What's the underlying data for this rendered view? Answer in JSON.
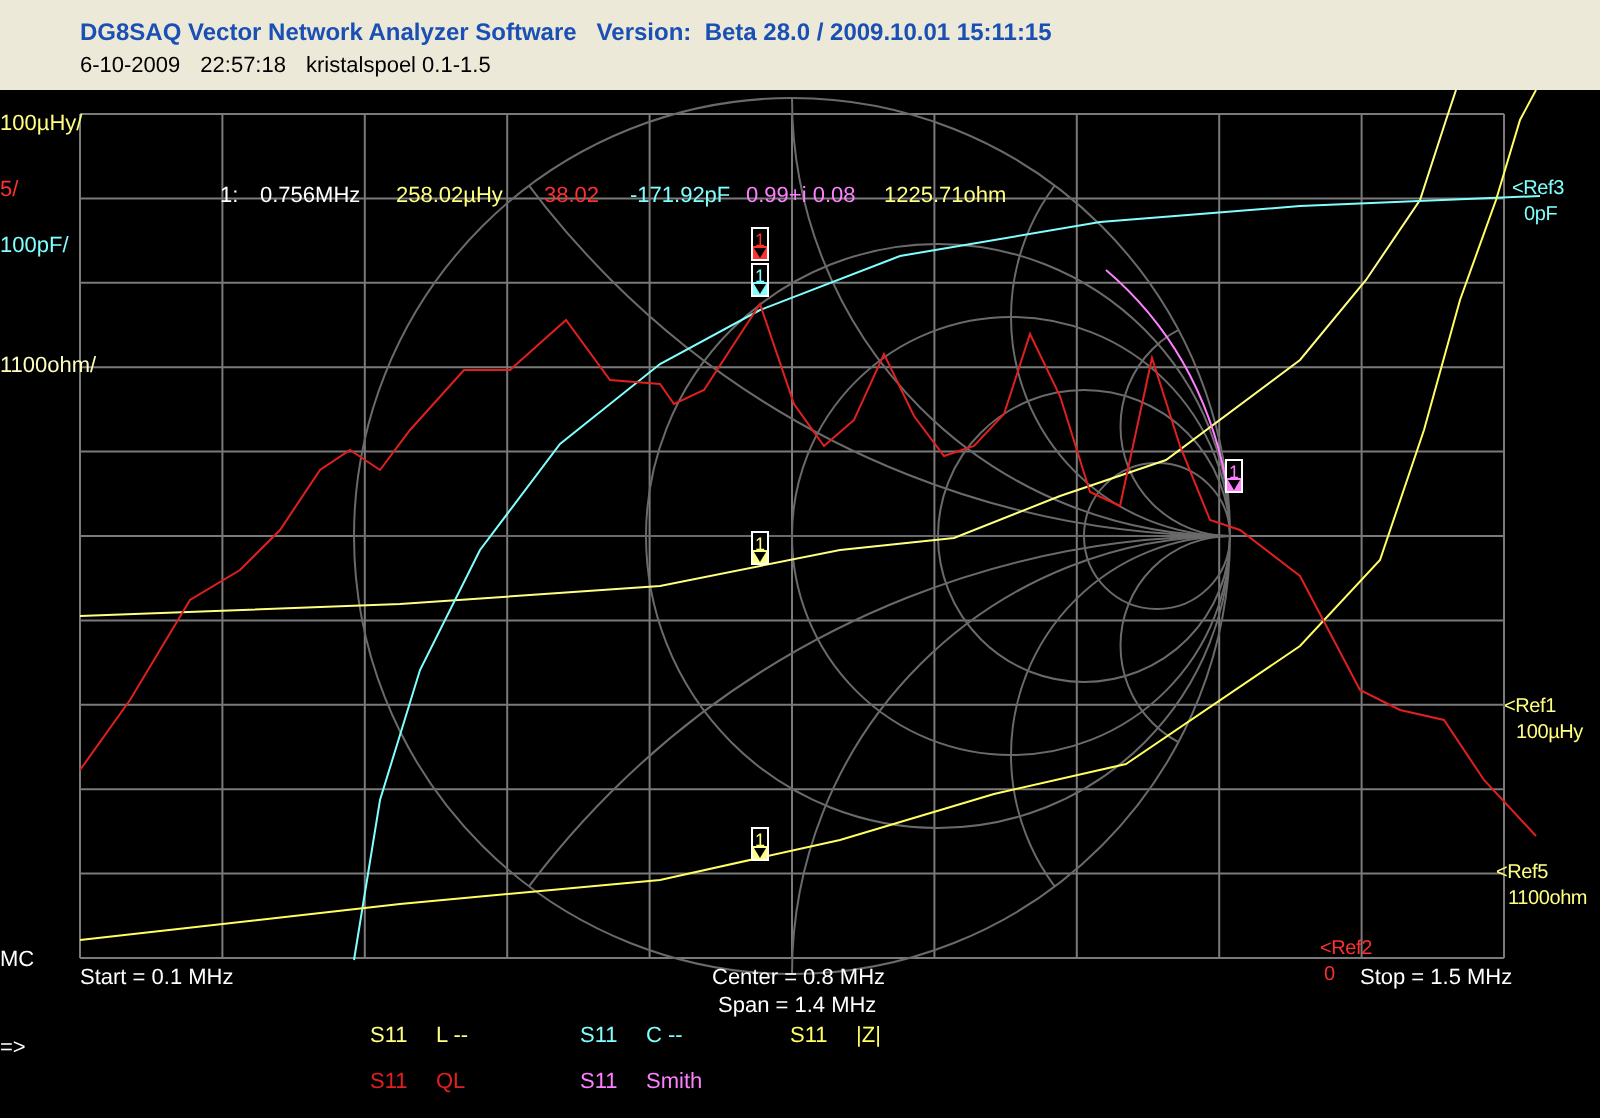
{
  "window": {
    "title": "DG8SAQ Vector Network Analyzer Software   Version:  Beta 28.0 / 2009.10.01 15:11:15"
  },
  "info": {
    "date": "6-10-2009",
    "time": "22:57:18",
    "name": "kristalspoel 0.1-1.5"
  },
  "scale_labels": [
    {
      "text": "100µHy/",
      "color": "#ffff80"
    },
    {
      "text": "5/",
      "color": "#ff3030"
    },
    {
      "text": "100pF/",
      "color": "#80ffff"
    },
    {
      "text": "1100ohm/",
      "color": "#ffffc0"
    }
  ],
  "marker_readout": [
    {
      "text": "1:",
      "color": "#ffffff"
    },
    {
      "text": "0.756MHz",
      "color": "#ffffff"
    },
    {
      "text": "258.02µHy",
      "color": "#ffff80"
    },
    {
      "text": "38.02",
      "color": "#ff3030"
    },
    {
      "text": "-171.92pF",
      "color": "#80ffff"
    },
    {
      "text": "0.99+i 0.08",
      "color": "#ff80ff"
    },
    {
      "text": "1225.71ohm",
      "color": "#ffff80"
    }
  ],
  "references": [
    {
      "label": "<Ref3",
      "value": "0pF",
      "color": "#80ffff"
    },
    {
      "label": "<Ref1",
      "value": "100µHy",
      "color": "#ffff80"
    },
    {
      "label": "<Ref5",
      "value": "1100ohm",
      "color": "#ffff80"
    },
    {
      "label": "<Ref2",
      "value": "0",
      "color": "#ff3030"
    }
  ],
  "markers": [
    {
      "label": "1",
      "color": "#ff3030"
    },
    {
      "label": "1",
      "color": "#80ffff"
    },
    {
      "label": "1",
      "color": "#ffff80"
    },
    {
      "label": "1",
      "color": "#ffff80"
    },
    {
      "label": "1",
      "color": "#ff80ff"
    }
  ],
  "mode_label": "MC",
  "frequency": {
    "start": "Start = 0.1 MHz",
    "center": "Center = 0.8 MHz",
    "span": "Span = 1.4 MHz",
    "stop": "Stop = 1.5 MHz"
  },
  "prompt": "=>",
  "legend": [
    {
      "param": "S11",
      "mode": "L --",
      "color": "#ffff80"
    },
    {
      "param": "S11",
      "mode": "C --",
      "color": "#80ffff"
    },
    {
      "param": "S11",
      "mode": "|Z|",
      "color": "#ffff60"
    },
    {
      "param": "S11",
      "mode": "QL",
      "color": "#e02020"
    },
    {
      "param": "S11",
      "mode": "Smith",
      "color": "#ff80ff"
    }
  ]
}
